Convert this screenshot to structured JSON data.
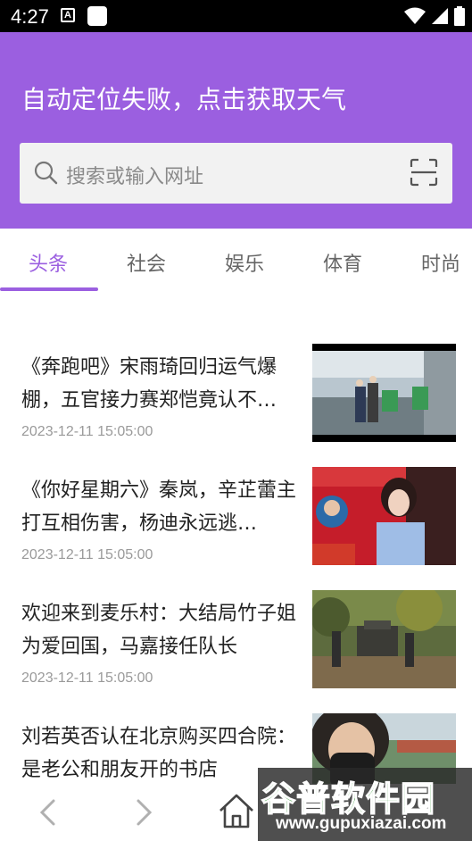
{
  "status": {
    "time": "4:27",
    "a_icon": "A"
  },
  "header": {
    "weather_text": "自动定位失败，点击获取天气",
    "search_placeholder": "搜索或输入网址",
    "accent_color": "#9b5fe0"
  },
  "tabs": [
    {
      "label": "头条",
      "active": true
    },
    {
      "label": "社会",
      "active": false
    },
    {
      "label": "娱乐",
      "active": false
    },
    {
      "label": "体育",
      "active": false
    },
    {
      "label": "时尚",
      "active": false
    }
  ],
  "news": [
    {
      "title": "《奔跑吧》宋雨琦回归运气爆棚，五官接力赛郑恺竟认不…",
      "time": "2023-12-11 15:05:00",
      "thumb_icon": "variety-show-photo"
    },
    {
      "title": "《你好星期六》秦岚，辛芷蕾主打互相伤害，杨迪永远逃…",
      "time": "2023-12-11 15:05:00",
      "thumb_icon": "tv-show-photo"
    },
    {
      "title": "欢迎来到麦乐村：大结局竹子姐为爱回国，马嘉接任队长",
      "time": "2023-12-11 15:05:00",
      "thumb_icon": "outdoor-scene-photo"
    },
    {
      "title": "刘若英否认在北京购买四合院：是老公和朋友开的书店",
      "time": "",
      "thumb_icon": "masked-person-photo"
    }
  ],
  "watermark": {
    "title": "谷普软件园",
    "url": "www.gupuxiazai.com"
  }
}
